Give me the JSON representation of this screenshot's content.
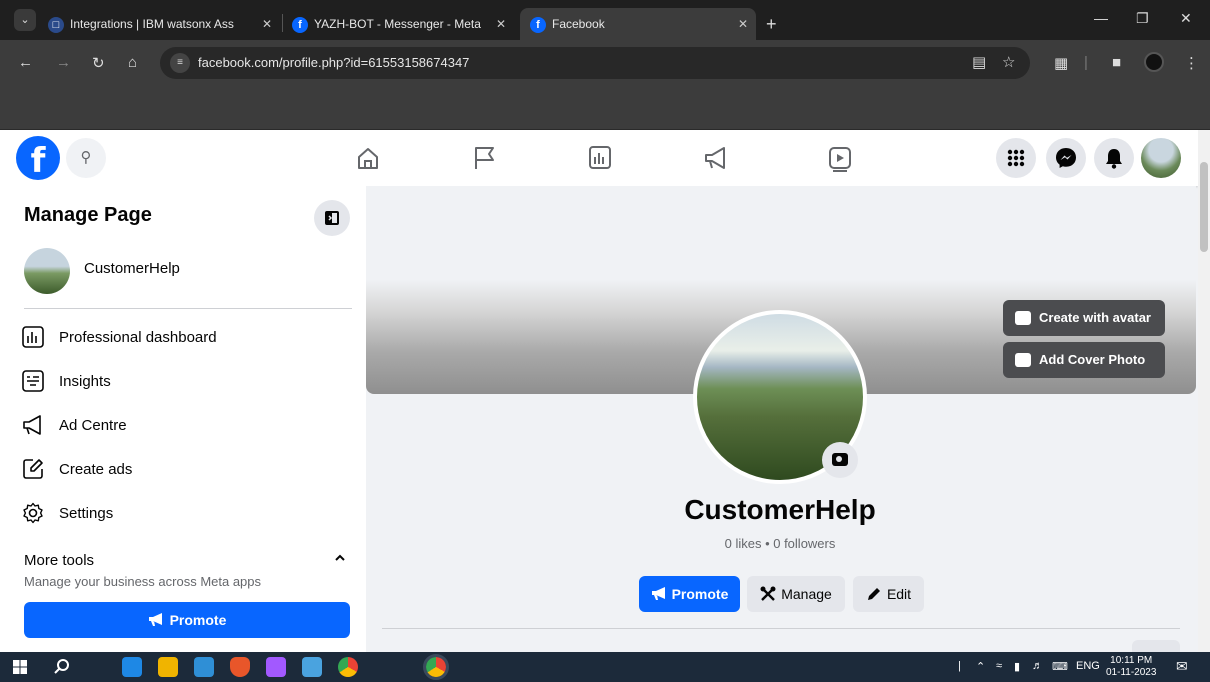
{
  "browser": {
    "tabs": [
      {
        "title": "Integrations | IBM watsonx Ass",
        "favicon": "ibm-icon"
      },
      {
        "title": "YAZH-BOT - Messenger - Meta",
        "favicon": "facebook-icon"
      },
      {
        "title": "Facebook",
        "favicon": "facebook-icon",
        "active": true
      }
    ],
    "url": "facebook.com/profile.php?id=61553158674347"
  },
  "fb": {
    "logo": "f",
    "accent": "#0866ff"
  },
  "sidebar": {
    "title": "Manage Page",
    "page_name": "CustomerHelp",
    "items": [
      {
        "label": "Professional dashboard",
        "icon": "dashboard-icon"
      },
      {
        "label": "Insights",
        "icon": "insights-icon"
      },
      {
        "label": "Ad Centre",
        "icon": "megaphone-icon"
      },
      {
        "label": "Create ads",
        "icon": "pencil-square-icon"
      },
      {
        "label": "Settings",
        "icon": "gear-icon"
      }
    ],
    "more_tools": "More tools",
    "more_tools_sub": "Manage your business across Meta apps",
    "promote_label": "Promote"
  },
  "cover": {
    "create_avatar_label": "Create with avatar",
    "add_cover_label": "Add Cover Photo"
  },
  "profile": {
    "name": "CustomerHelp",
    "stats": "0 likes • 0 followers",
    "promote_label": "Promote",
    "manage_label": "Manage",
    "edit_label": "Edit"
  },
  "taskbar": {
    "lang": "ENG",
    "time": "10:11 PM",
    "date": "01-11-2023"
  }
}
